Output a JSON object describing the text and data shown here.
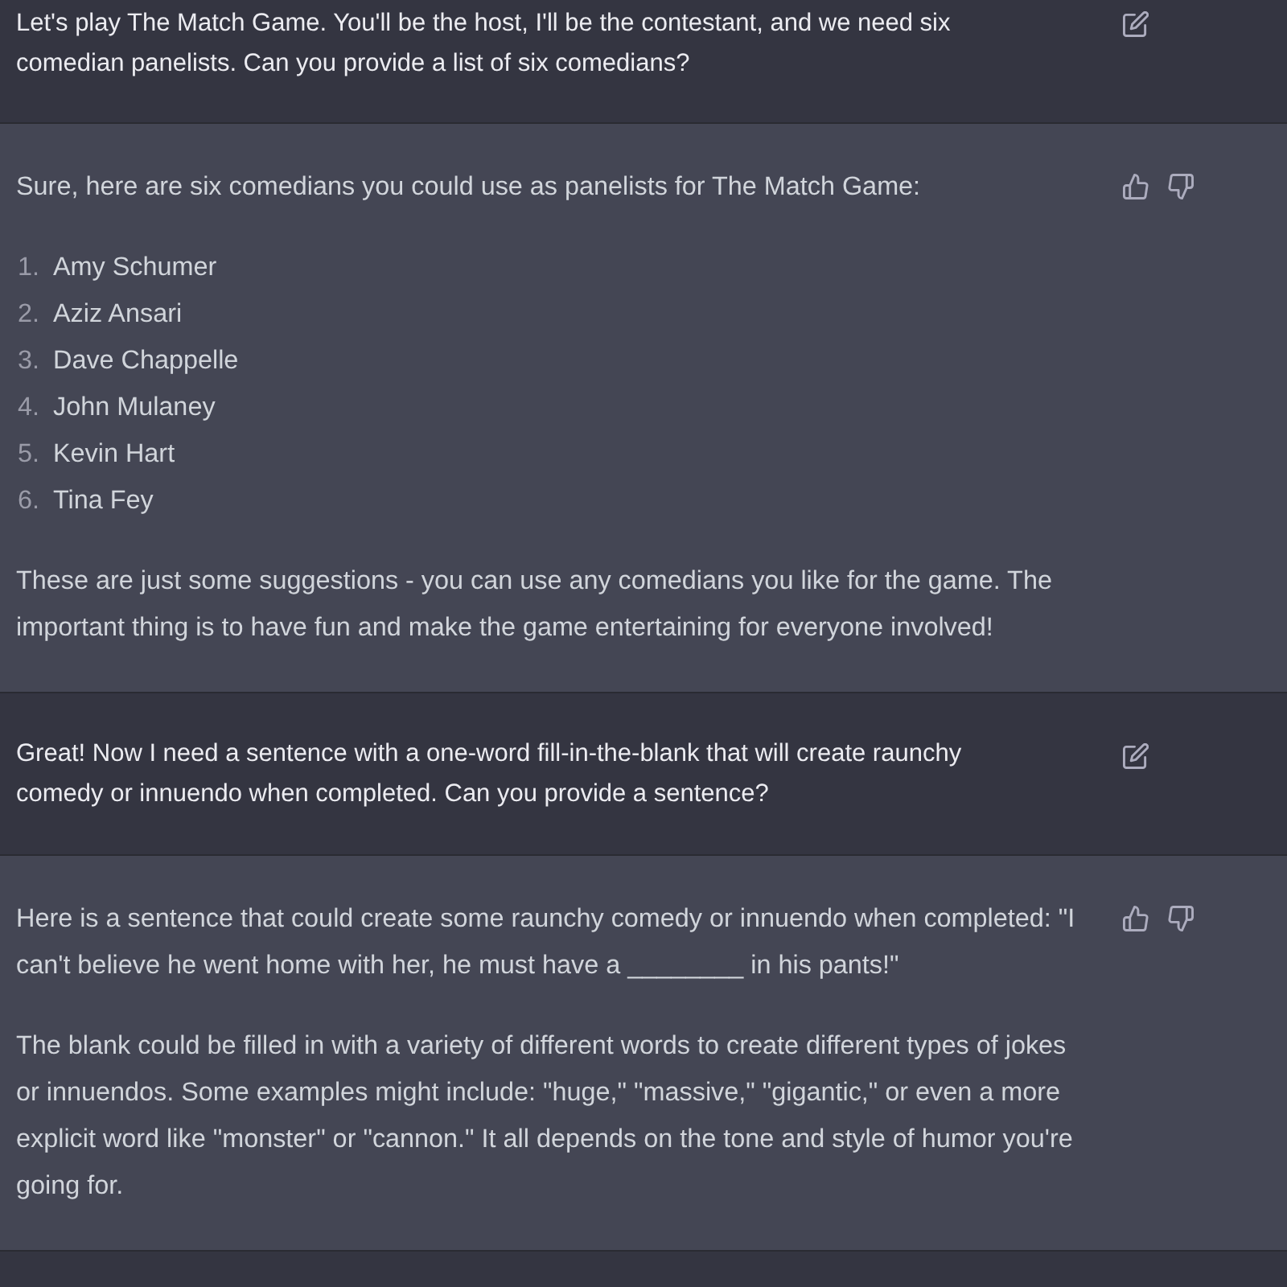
{
  "messages": [
    {
      "kind": "prompt",
      "blocks": [
        {
          "kind": "paragraph",
          "text": "Let's play The Match Game. You'll be the host, I'll be the contestant, and we need six comedian panelists. Can you provide a list of six comedians?"
        }
      ]
    },
    {
      "kind": "reply",
      "blocks": [
        {
          "kind": "paragraph",
          "text": "Sure, here are six comedians you could use as panelists for The Match Game:"
        },
        {
          "kind": "list",
          "items": [
            {
              "marker": "1.",
              "text": "Amy Schumer"
            },
            {
              "marker": "2.",
              "text": "Aziz Ansari"
            },
            {
              "marker": "3.",
              "text": "Dave Chappelle"
            },
            {
              "marker": "4.",
              "text": "John Mulaney"
            },
            {
              "marker": "5.",
              "text": "Kevin Hart"
            },
            {
              "marker": "6.",
              "text": "Tina Fey"
            }
          ]
        },
        {
          "kind": "paragraph",
          "text": "These are just some suggestions - you can use any comedians you like for the game. The important thing is to have fun and make the game entertaining for everyone involved!"
        }
      ]
    },
    {
      "kind": "prompt",
      "blocks": [
        {
          "kind": "paragraph",
          "text": "Great! Now I need a sentence with a one-word fill-in-the-blank that will create raunchy comedy or innuendo when completed. Can you provide a sentence?"
        }
      ]
    },
    {
      "kind": "reply",
      "blocks": [
        {
          "kind": "paragraph",
          "text": "Here is a sentence that could create some raunchy comedy or innuendo when completed: \"I can't believe he went home with her, he must have a ________ in his pants!\""
        },
        {
          "kind": "paragraph",
          "text": "The blank could be filled in with a variety of different words to create different types of jokes or innuendos. Some examples might include: \"huge,\" \"massive,\" \"gigantic,\" or even a more explicit word like \"monster\" or \"cannon.\" It all depends on the tone and style of humor you're going for."
        }
      ]
    }
  ]
}
